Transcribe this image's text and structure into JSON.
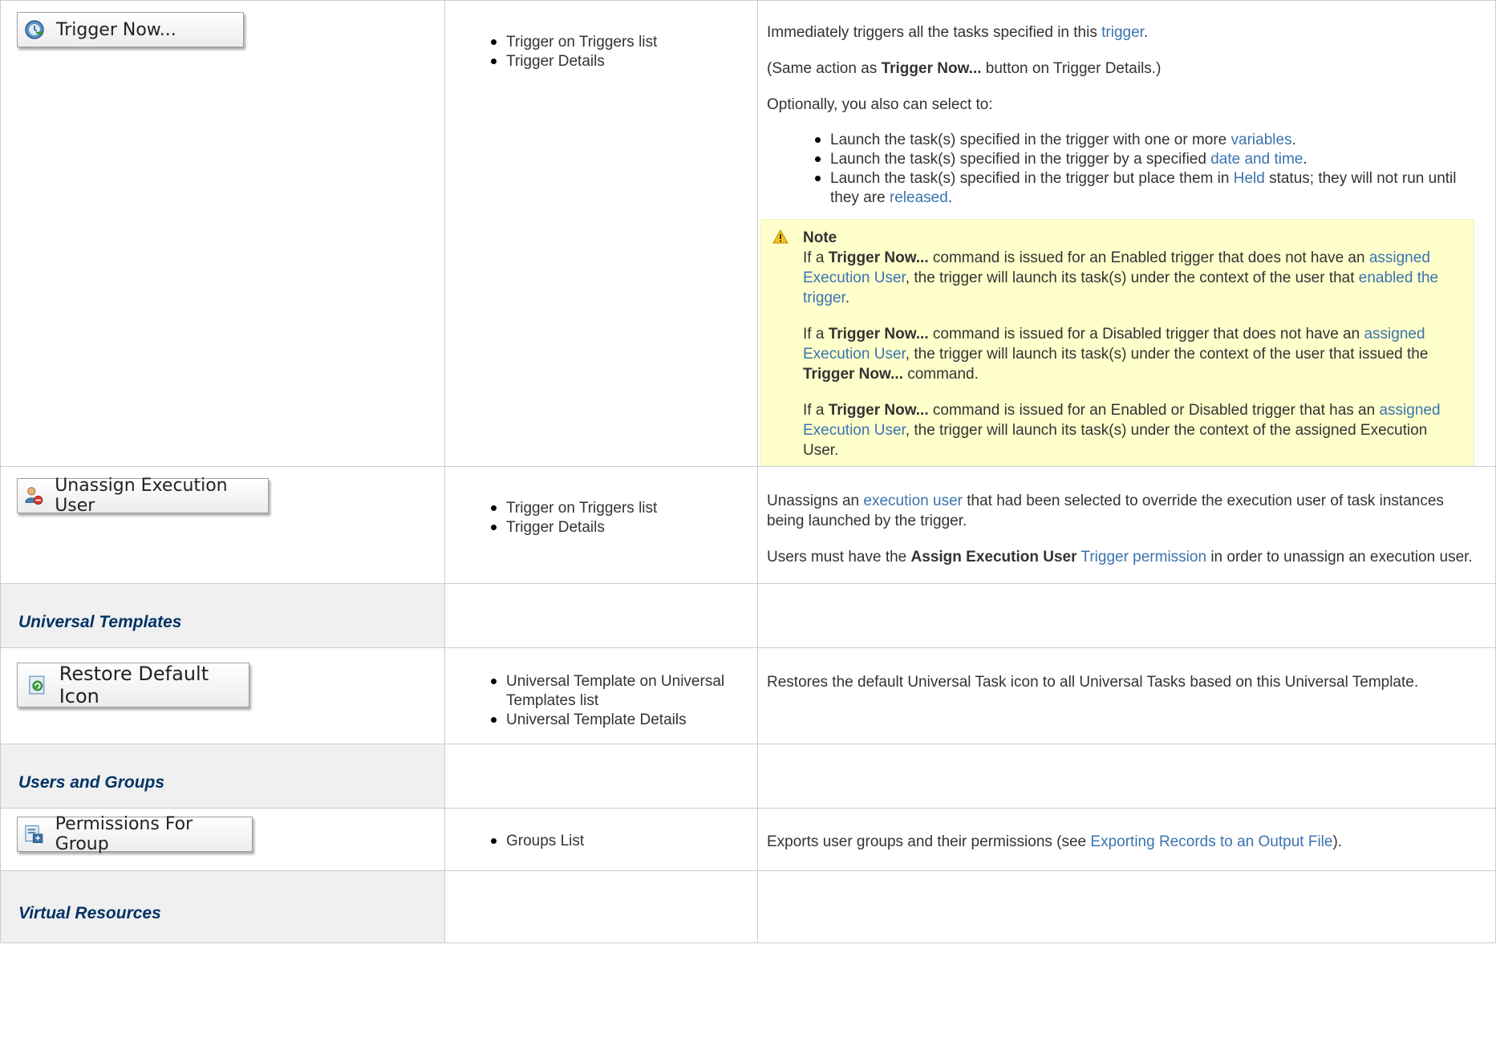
{
  "rows": {
    "trigger_now": {
      "button_label": "Trigger Now...",
      "icon": "trigger-now-icon",
      "where": [
        "Trigger on Triggers list",
        "Trigger Details"
      ],
      "p1_a": "Immediately triggers all the tasks specified in this ",
      "p1_link": "trigger",
      "p1_b": ".",
      "p2_a": "(Same action as ",
      "p2_bold": "Trigger Now...",
      "p2_b": " button on Trigger Details.)",
      "p3": "Optionally, you also can select to:",
      "opt1_a": "Launch the task(s) specified in the trigger with one or more ",
      "opt1_link": "variables",
      "opt1_b": ".",
      "opt2_a": "Launch the task(s) specified in the trigger by a specified ",
      "opt2_link": "date and time",
      "opt2_b": ".",
      "opt3_a": "Launch the task(s) specified in the trigger but place them in ",
      "opt3_link1": "Held",
      "opt3_b": " status; they will not run until they are ",
      "opt3_link2": "released",
      "opt3_c": ".",
      "note": {
        "title": "Note",
        "n1_a": "If a ",
        "n1_bold": "Trigger Now...",
        "n1_b": " command is issued for an Enabled trigger that does not have an ",
        "n1_link1": "assigned Execution User",
        "n1_c": ", the trigger will launch its task(s) under the context of the user that ",
        "n1_link2": "enabled the trigger",
        "n1_d": ".",
        "n2_a": "If a ",
        "n2_bold1": "Trigger Now...",
        "n2_b": " command is issued for a Disabled trigger that does not have an ",
        "n2_link": "assigned Execution User",
        "n2_c": ", the trigger will launch its task(s) under the context of the user that issued the ",
        "n2_bold2": "Trigger Now...",
        "n2_d": " command.",
        "n3_a": "If a ",
        "n3_bold": "Trigger Now...",
        "n3_b": " command is issued for an Enabled or Disabled trigger that has an ",
        "n3_link": "assigned Execution User",
        "n3_c": ", the trigger will launch its task(s) under the context of the assigned Execution User."
      }
    },
    "unassign": {
      "button_label": "Unassign Execution User",
      "icon": "user-remove-icon",
      "where": [
        "Trigger on Triggers list",
        "Trigger Details"
      ],
      "p1_a": "Unassigns an ",
      "p1_link": "execution user",
      "p1_b": " that had been selected to override the execution user of task instances being launched by the trigger.",
      "p2_a": "Users must have the ",
      "p2_bold": "Assign Execution User",
      "p2_space": " ",
      "p2_link": "Trigger permission",
      "p2_b": " in order to unassign an execution user."
    },
    "section_universal_templates": "Universal Templates",
    "restore_icon": {
      "button_label": "Restore Default Icon",
      "icon": "restore-icon",
      "where": [
        "Universal Template on Universal Templates list",
        "Universal Template Details"
      ],
      "p1": "Restores the default Universal Task icon to all Universal Tasks based on this Universal Template."
    },
    "section_users_groups": "Users and Groups",
    "permissions_group": {
      "button_label": "Permissions For Group",
      "icon": "export-icon",
      "where": [
        "Groups List"
      ],
      "p1_a": "Exports user groups and their permissions (see ",
      "p1_link": "Exporting Records to an Output File",
      "p1_b": ")."
    },
    "section_virtual_resources": "Virtual Resources"
  },
  "colors": {
    "link": "#3b73af",
    "section_title": "#003366",
    "note_bg": "#ffffcc"
  }
}
